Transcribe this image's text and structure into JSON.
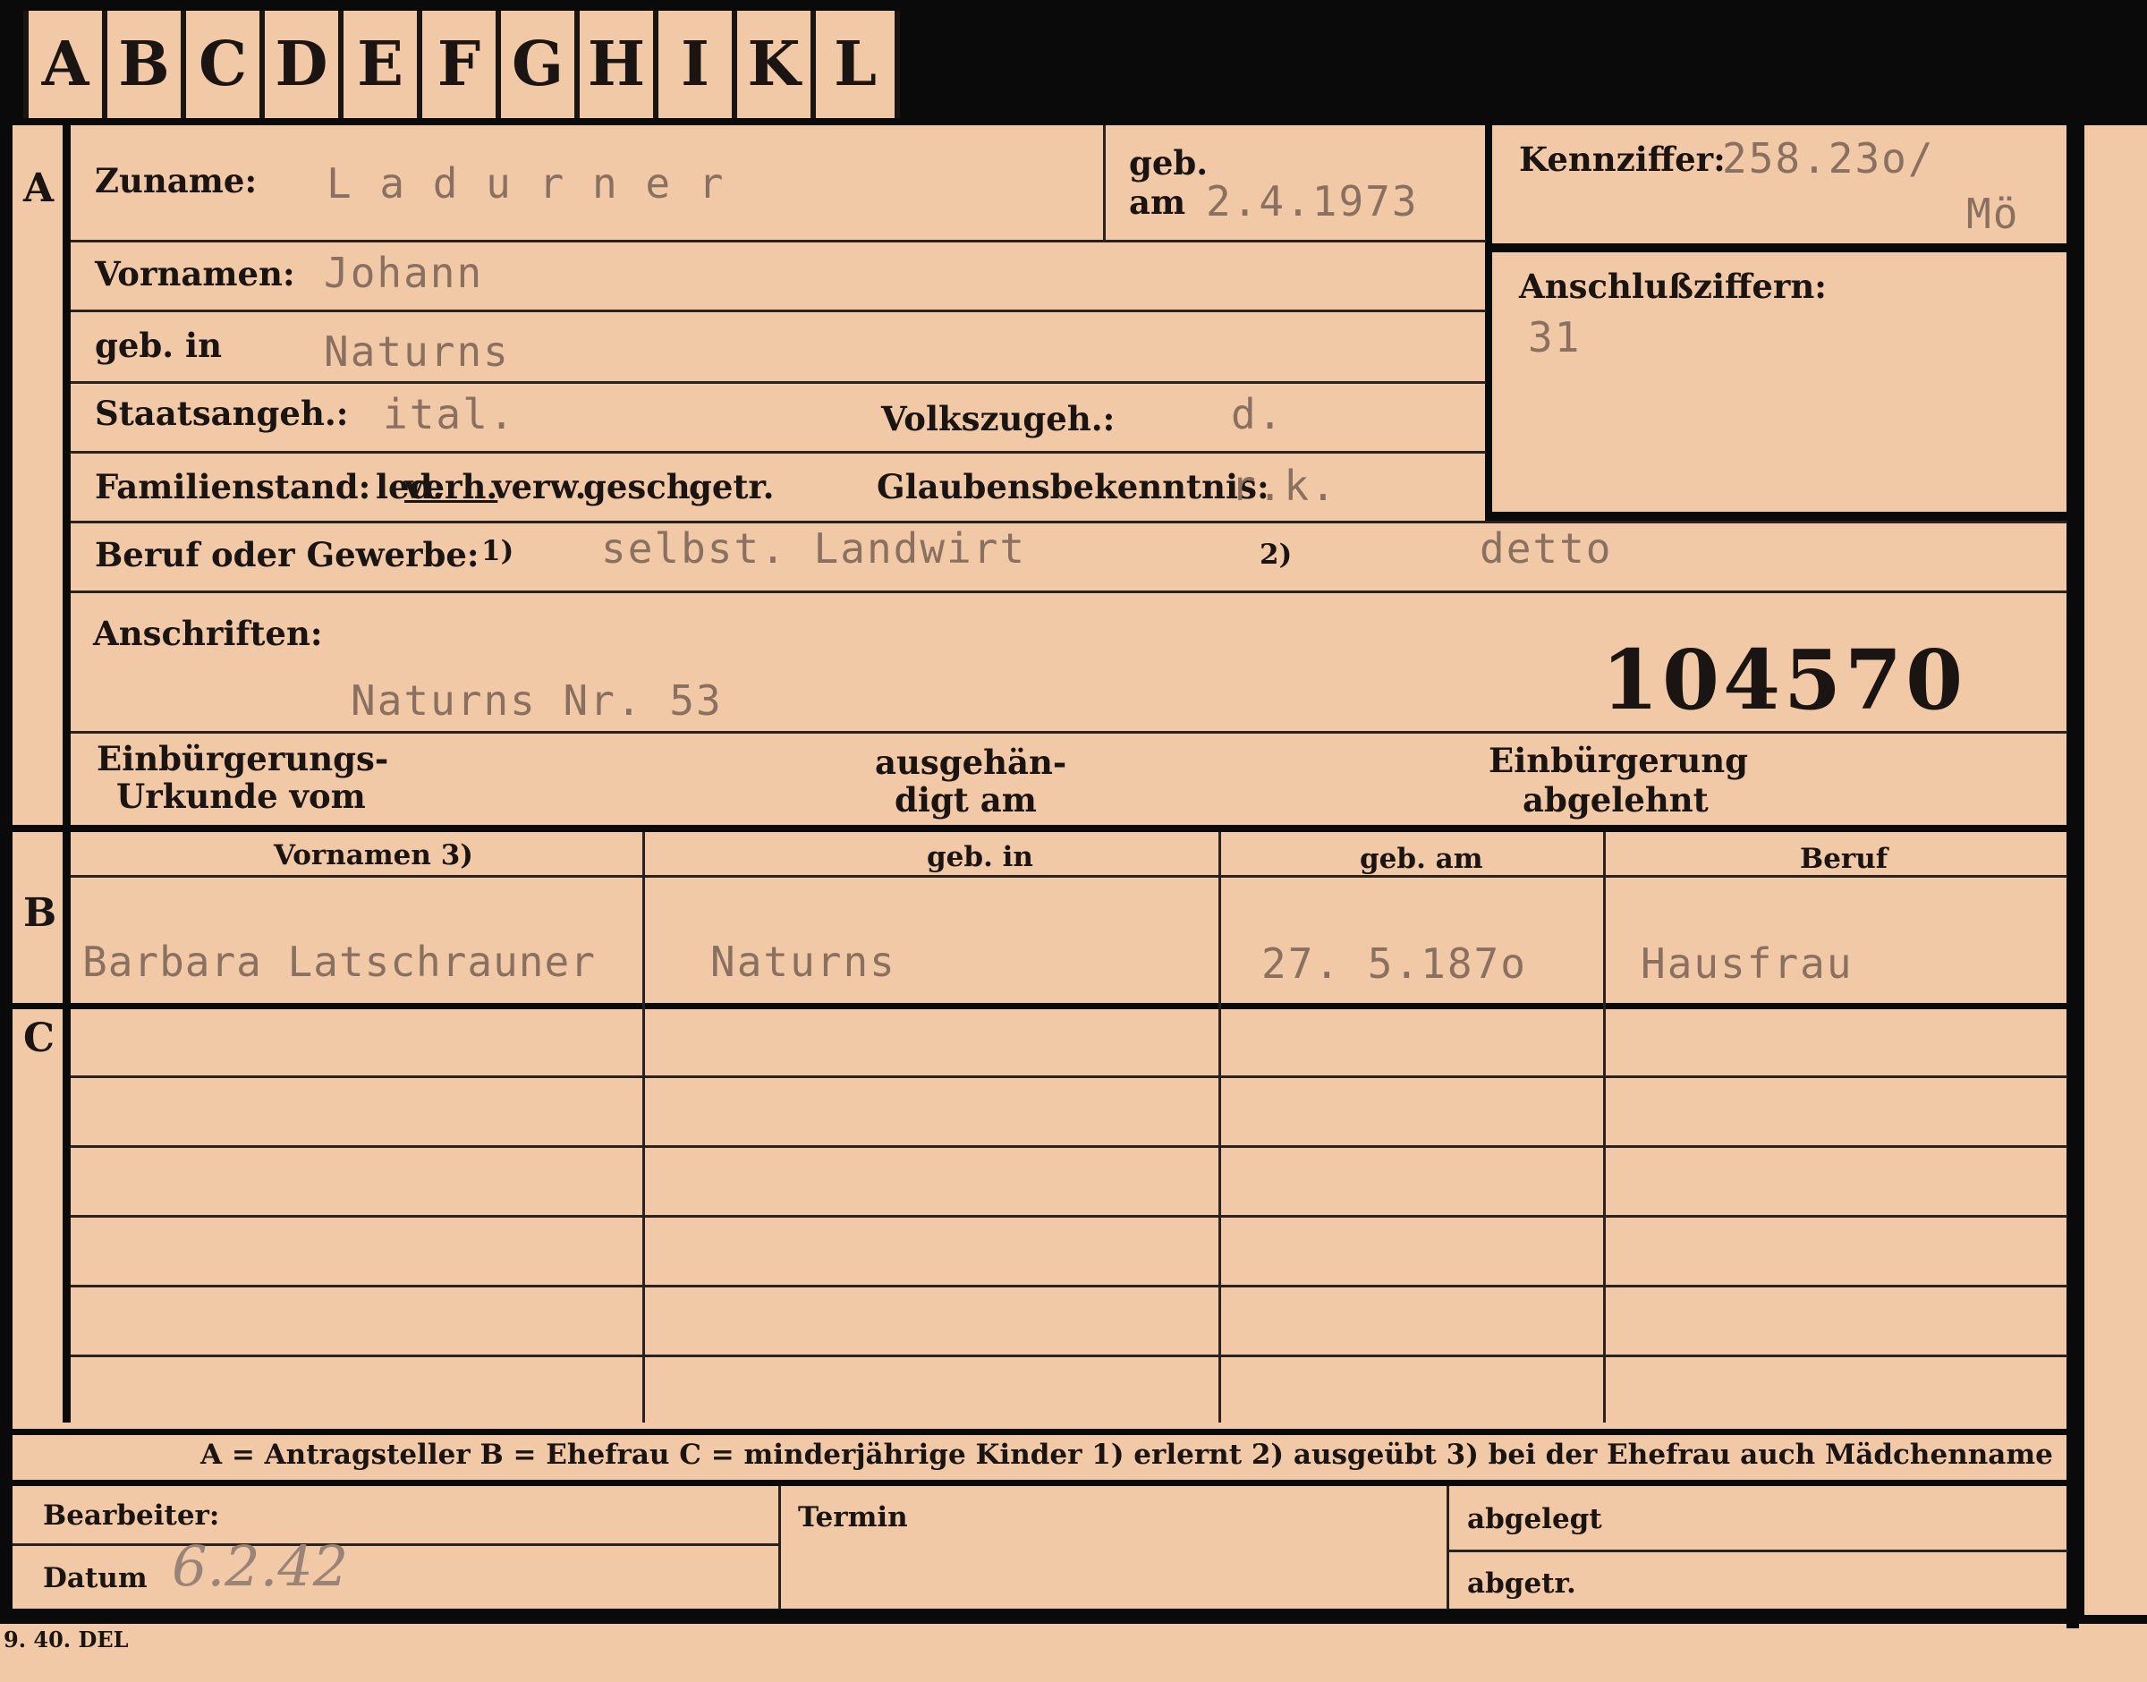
{
  "tabs": [
    "A",
    "B",
    "C",
    "D",
    "E",
    "F",
    "G",
    "H",
    "I",
    "K",
    "L"
  ],
  "sections": {
    "a": "A",
    "b": "B",
    "c": "C"
  },
  "labels": {
    "zuname": "Zuname:",
    "geb": "geb.",
    "am": "am",
    "vornamen": "Vornamen:",
    "geb_in": "geb. in",
    "staatsangeh": "Staatsangeh.:",
    "volkszugeh": "Volkszugeh.:",
    "familienstand": "Familienstand:",
    "fam_options": [
      "led.",
      "verh.",
      "verw.",
      "gesch.",
      "getr."
    ],
    "glaubens": "Glaubensbekenntnis:",
    "kennziffer": "Kennziffer:",
    "anschluss": "Anschlußziffern:",
    "beruf": "Beruf oder Gewerbe:",
    "beruf_note1": "1)",
    "beruf_note2": "2)",
    "anschriften": "Anschriften:",
    "einb_urkunde_1": "Einbürgerungs-",
    "einb_urkunde_2": "Urkunde vom",
    "ausgehaendigt_1": "ausgehän-",
    "ausgehaendigt_2": "digt am",
    "einb_abgelehnt_1": "Einbürgerung",
    "einb_abgelehnt_2": "abgelehnt",
    "col_vornamen": "Vornamen 3)",
    "col_geb_in": "geb. in",
    "col_geb_am": "geb. am",
    "col_beruf": "Beruf",
    "legend": "A = Antragsteller   B = Ehefrau   C = minderjährige Kinder   1) erlernt   2) ausgeübt   3) bei der Ehefrau auch Mädchenname",
    "bearbeiter": "Bearbeiter:",
    "datum": "Datum",
    "termin": "Termin",
    "abgelegt": "abgelegt",
    "abgetr": "abgetr.",
    "printer": "9. 40. DEL"
  },
  "values": {
    "zuname": "L a d u r n e r",
    "geb_am": "2.4.1973",
    "kennziffer": "258.23o/",
    "kennziffer_suffix": "Mö",
    "vornamen": "Johann",
    "anschluss": "31",
    "geb_in": "Naturns",
    "staatsangeh": "ital.",
    "volkszugeh": "d.",
    "glaubens": "r.k.",
    "beruf_erlernt": "selbst. Landwirt",
    "beruf_ausgeuebt": "detto",
    "anschrift": "Naturns Nr. 53",
    "stamp_number": "104570",
    "datum": "6.2.42"
  },
  "spouse": {
    "vornamen": "Barbara Latschrauner",
    "geb_in": "Naturns",
    "geb_am": "27. 5.187o",
    "beruf": "Hausfrau"
  },
  "colors": {
    "paper": "#f1c9a6",
    "ink": "#1a1412",
    "typewriter": "#8a7060",
    "border": "#0b0a0a"
  }
}
